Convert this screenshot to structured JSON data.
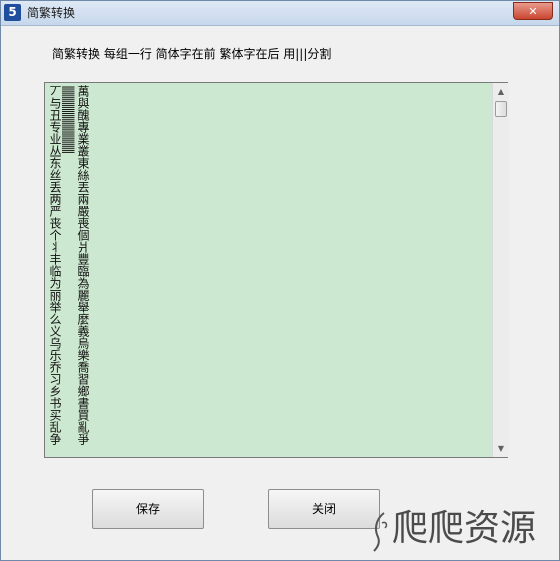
{
  "window": {
    "title": "简繁转换",
    "icon_glyph": "5"
  },
  "instructions": "简繁转换 每组一行 简体字在前 繁体字在后 用|||分割",
  "textbox": {
    "simplified_column": "丆与丑专业丛东丝丢两严丧个丬丰临为丽举么义乌乐乔习乡书买乱争",
    "separator_column": "|||||||||||||||||||||||||||||||||",
    "traditional_column": "萬與醜專業叢東絲丟兩嚴喪個爿豐臨為麗舉麼義烏樂喬習鄉書買亂爭"
  },
  "buttons": {
    "save": "保存",
    "close": "关闭"
  },
  "watermark": {
    "text": "爬爬资源"
  }
}
